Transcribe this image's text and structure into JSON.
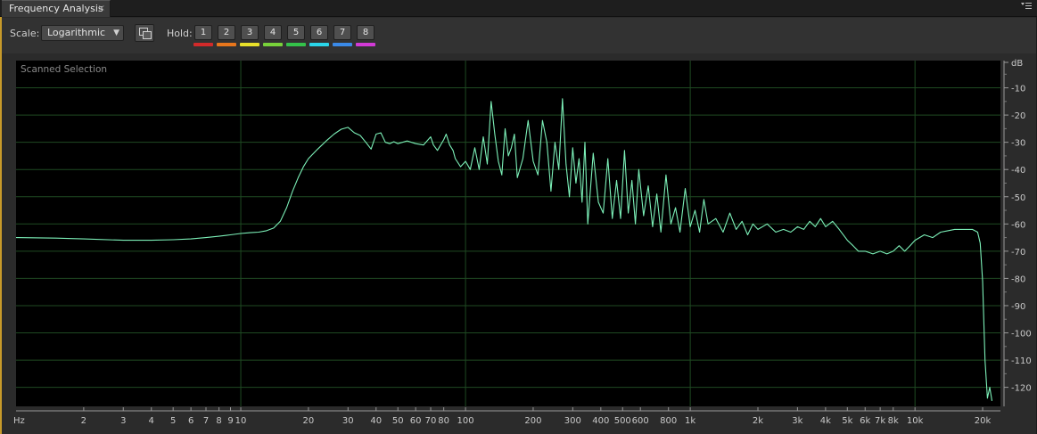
{
  "panel": {
    "tab_title": "Frequency Analysis",
    "close_glyph": "×",
    "menu_icon": "panel-menu-icon"
  },
  "toolbar": {
    "scale_label": "Scale:",
    "scale_value": "Logarithmic",
    "scale_arrow": "▼",
    "copy_icon": "copy-graph-icon",
    "hold_label": "Hold:",
    "hold_buttons": [
      {
        "label": "1",
        "color": "#d22a2a"
      },
      {
        "label": "2",
        "color": "#e8761c"
      },
      {
        "label": "3",
        "color": "#e8e02a"
      },
      {
        "label": "4",
        "color": "#78d23a"
      },
      {
        "label": "5",
        "color": "#34c24a"
      },
      {
        "label": "6",
        "color": "#2ad6ea"
      },
      {
        "label": "7",
        "color": "#3a8ae8"
      },
      {
        "label": "8",
        "color": "#d23ad6"
      }
    ]
  },
  "chart_data": {
    "type": "line",
    "annotation": "Scanned Selection",
    "x_scale": "log",
    "xlim": [
      1,
      24000
    ],
    "ylim": [
      -127,
      0
    ],
    "ylabel": "dB",
    "xunit_label": "Hz",
    "y_ticks": [
      {
        "value": -10,
        "label": "-10"
      },
      {
        "value": -20,
        "label": "-20"
      },
      {
        "value": -30,
        "label": "-30"
      },
      {
        "value": -40,
        "label": "-40"
      },
      {
        "value": -50,
        "label": "-50"
      },
      {
        "value": -60,
        "label": "-60"
      },
      {
        "value": -70,
        "label": "-70"
      },
      {
        "value": -80,
        "label": "-80"
      },
      {
        "value": -90,
        "label": "-90"
      },
      {
        "value": -100,
        "label": "-100"
      },
      {
        "value": -110,
        "label": "-110"
      },
      {
        "value": -120,
        "label": "-120"
      }
    ],
    "x_ticks": [
      {
        "value": 2,
        "label": "2"
      },
      {
        "value": 3,
        "label": "3"
      },
      {
        "value": 4,
        "label": "4"
      },
      {
        "value": 5,
        "label": "5"
      },
      {
        "value": 6,
        "label": "6"
      },
      {
        "value": 7,
        "label": "7"
      },
      {
        "value": 8,
        "label": "8"
      },
      {
        "value": 9,
        "label": "9"
      },
      {
        "value": 10,
        "label": "10"
      },
      {
        "value": 20,
        "label": "20"
      },
      {
        "value": 30,
        "label": "30"
      },
      {
        "value": 40,
        "label": "40"
      },
      {
        "value": 50,
        "label": "50"
      },
      {
        "value": 60,
        "label": "60"
      },
      {
        "value": 70,
        "label": "70"
      },
      {
        "value": 80,
        "label": "80"
      },
      {
        "value": 100,
        "label": "100"
      },
      {
        "value": 200,
        "label": "200"
      },
      {
        "value": 300,
        "label": "300"
      },
      {
        "value": 400,
        "label": "400"
      },
      {
        "value": 500,
        "label": "500"
      },
      {
        "value": 600,
        "label": "600"
      },
      {
        "value": 800,
        "label": "800"
      },
      {
        "value": 1000,
        "label": "1k"
      },
      {
        "value": 2000,
        "label": "2k"
      },
      {
        "value": 3000,
        "label": "3k"
      },
      {
        "value": 4000,
        "label": "4k"
      },
      {
        "value": 5000,
        "label": "5k"
      },
      {
        "value": 6000,
        "label": "6k"
      },
      {
        "value": 7000,
        "label": "7k"
      },
      {
        "value": 8000,
        "label": "8k"
      },
      {
        "value": 10000,
        "label": "10k"
      },
      {
        "value": 20000,
        "label": "20k"
      }
    ],
    "major_gridlines_x": [
      10,
      100,
      1000,
      10000
    ],
    "grid": true,
    "line_color": "#7cf0b8",
    "background_color": "#000000",
    "grid_color": "#1f4a22",
    "series": [
      {
        "x": [
          1,
          1.5,
          2,
          3,
          4,
          5,
          6,
          7,
          8,
          9,
          10,
          11,
          12,
          13,
          14,
          15,
          16,
          17,
          18,
          19,
          20,
          22,
          24,
          26,
          28,
          30,
          32,
          34,
          36,
          38,
          40,
          42,
          44,
          46,
          48,
          50,
          55,
          60,
          65,
          70,
          72,
          75,
          80,
          82,
          85,
          88,
          90,
          95,
          100,
          105,
          110,
          115,
          120,
          125,
          130,
          135,
          140,
          145,
          150,
          155,
          160,
          165,
          170,
          180,
          190,
          200,
          210,
          220,
          230,
          240,
          250,
          260,
          270,
          280,
          290,
          300,
          310,
          320,
          330,
          340,
          350,
          370,
          390,
          410,
          430,
          450,
          470,
          490,
          510,
          530,
          550,
          570,
          590,
          620,
          650,
          680,
          710,
          740,
          780,
          820,
          860,
          900,
          950,
          1000,
          1050,
          1100,
          1150,
          1200,
          1300,
          1400,
          1500,
          1600,
          1700,
          1800,
          1900,
          2000,
          2200,
          2400,
          2600,
          2800,
          3000,
          3200,
          3400,
          3600,
          3800,
          4000,
          4300,
          4600,
          5000,
          5300,
          5600,
          6000,
          6500,
          7000,
          7500,
          8000,
          8500,
          9000,
          9500,
          10000,
          11000,
          12000,
          13000,
          14000,
          15000,
          16000,
          17000,
          18000,
          19000,
          19500,
          20000,
          20500,
          21000,
          21500,
          22000
        ],
        "y": [
          -65,
          -65.2,
          -65.5,
          -66,
          -66,
          -65.8,
          -65.5,
          -65,
          -64.5,
          -64,
          -63.5,
          -63.2,
          -63,
          -62.5,
          -61.5,
          -59,
          -54,
          -48,
          -43,
          -39,
          -36,
          -32.5,
          -29.5,
          -27,
          -25.2,
          -24.5,
          -26.5,
          -27.5,
          -30,
          -32.5,
          -27,
          -26.5,
          -30,
          -30.5,
          -29.8,
          -30.5,
          -29.5,
          -30.5,
          -31,
          -28,
          -31,
          -33,
          -29,
          -27,
          -31,
          -33,
          -36,
          -39,
          -37,
          -40,
          -32,
          -40,
          -28,
          -38,
          -15,
          -27,
          -37,
          -42,
          -25,
          -35,
          -32,
          -27,
          -43,
          -36,
          -22,
          -37,
          -42,
          -22,
          -30,
          -48,
          -30,
          -40,
          -14,
          -38,
          -50,
          -32,
          -45,
          -36,
          -52,
          -30,
          -60,
          -34,
          -52,
          -56,
          -36,
          -58,
          -44,
          -58,
          -33,
          -56,
          -44,
          -60,
          -40,
          -57,
          -46,
          -61,
          -49,
          -63,
          -42,
          -60,
          -54,
          -63,
          -47,
          -61,
          -55,
          -63,
          -51,
          -60,
          -58,
          -63,
          -56,
          -62,
          -59,
          -64,
          -60,
          -62,
          -60,
          -63,
          -62,
          -63,
          -61,
          -62,
          -59,
          -61,
          -58,
          -61,
          -59,
          -62,
          -66,
          -68,
          -70,
          -70,
          -71,
          -70,
          -71,
          -70,
          -68,
          -70,
          -68,
          -66,
          -64,
          -65,
          -63,
          -62.5,
          -62,
          -62,
          -62,
          -62,
          -63,
          -67,
          -81,
          -110,
          -124,
          -120,
          -125
        ]
      }
    ]
  }
}
